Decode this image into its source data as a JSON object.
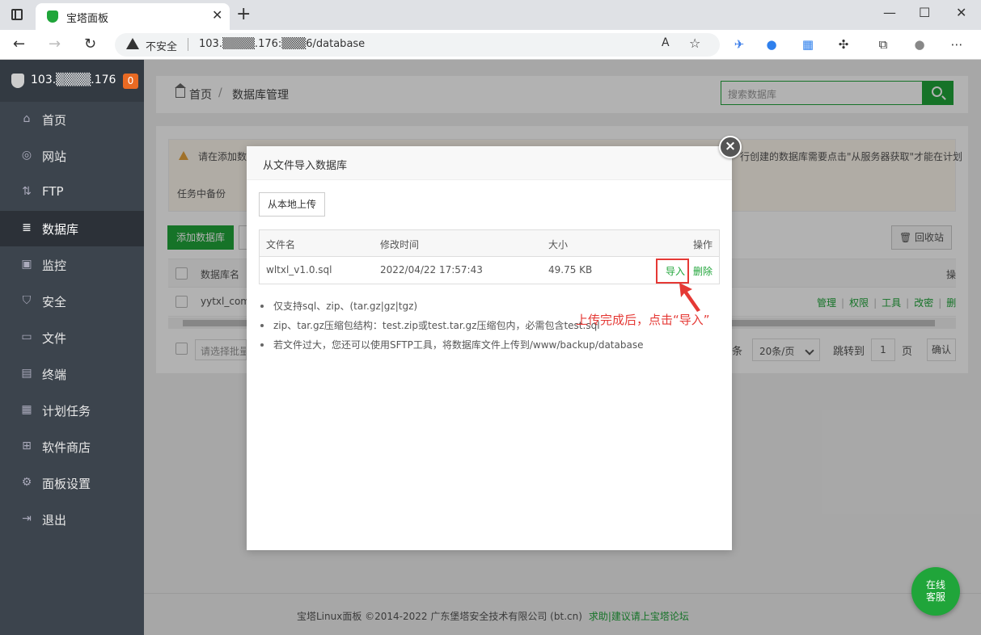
{
  "browser": {
    "tab_title": "宝塔面板",
    "insecure_label": "不安全",
    "url": "103.▒▒▒▒.176:▒▒▒6/database"
  },
  "sidebar": {
    "server_ip": "103.▒▒▒▒.176",
    "badge": "0",
    "items": [
      {
        "label": "首页",
        "icon": "home-icon"
      },
      {
        "label": "网站",
        "icon": "globe-icon"
      },
      {
        "label": "FTP",
        "icon": "ftp-icon"
      },
      {
        "label": "数据库",
        "icon": "database-icon"
      },
      {
        "label": "监控",
        "icon": "monitor-icon"
      },
      {
        "label": "安全",
        "icon": "shield-icon"
      },
      {
        "label": "文件",
        "icon": "folder-icon"
      },
      {
        "label": "终端",
        "icon": "terminal-icon"
      },
      {
        "label": "计划任务",
        "icon": "calendar-icon"
      },
      {
        "label": "软件商店",
        "icon": "apps-icon"
      },
      {
        "label": "面板设置",
        "icon": "gear-icon"
      },
      {
        "label": "退出",
        "icon": "logout-icon"
      }
    ]
  },
  "header": {
    "crumb_home": "首页",
    "crumb_sep": "/",
    "crumb_current": "数据库管理",
    "search_placeholder": "搜索数据库"
  },
  "content": {
    "alert_left": "请在添加数",
    "alert_right": "行创建的数据库需要点击\"从服务器获取\"才能在计划",
    "alert_line2": "任务中备份",
    "add_button": "添加数据库",
    "recycle_button": "回收站",
    "col_dbname": "数据库名",
    "row_dbname": "yytxl_com",
    "ops": [
      "管理",
      "权限",
      "工具",
      "改密",
      "删"
    ],
    "hdr_op_partial": "操",
    "batch_placeholder": "请选择批量",
    "pager_tiao": "条",
    "pager_size": "20条/页",
    "pager_jump": "跳转到",
    "pager_num": "1",
    "pager_ye": "页",
    "pager_ok": "确认"
  },
  "modal": {
    "title": "从文件导入数据库",
    "upload_button": "从本地上传",
    "columns": {
      "name": "文件名",
      "mtime": "修改时间",
      "size": "大小",
      "op": "操作"
    },
    "file": {
      "name": "wltxl_v1.0.sql",
      "mtime": "2022/04/22 17:57:43",
      "size": "49.75 KB"
    },
    "import_label": "导入",
    "delete_label": "删除",
    "notes": [
      "仅支持sql、zip、(tar.gz|gz|tgz)",
      "zip、tar.gz压缩包结构：test.zip或test.tar.gz压缩包内，必需包含test.sql",
      "若文件过大，您还可以使用SFTP工具，将数据库文件上传到/www/backup/database"
    ]
  },
  "annotation": "上传完成后，点击“导入”",
  "footer": {
    "copyright": "宝塔Linux面板 ©2014-2022 广东堡塔安全技术有限公司 (bt.cn)",
    "link": "求助|建议请上宝塔论坛"
  },
  "chat_bubble": {
    "line1": "在线",
    "line2": "客服"
  },
  "colors": {
    "brand": "#20a53a",
    "annotation": "#e53935",
    "sidebar": "#3c444d"
  }
}
